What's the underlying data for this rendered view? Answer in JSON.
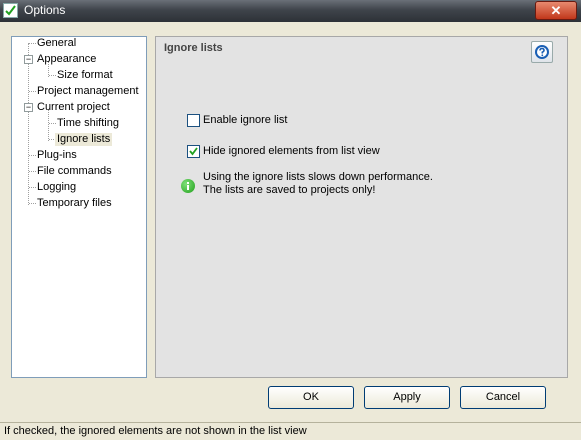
{
  "window": {
    "title": "Options",
    "close_glyph": "✕"
  },
  "tree": [
    {
      "label": "General",
      "level": 0
    },
    {
      "label": "Appearance",
      "level": 0
    },
    {
      "label": "Size format",
      "level": 1
    },
    {
      "label": "Project management",
      "level": 0
    },
    {
      "label": "Current project",
      "level": 0
    },
    {
      "label": "Time shifting",
      "level": 1
    },
    {
      "label": "Ignore lists",
      "level": 1,
      "selected": true
    },
    {
      "label": "Plug-ins",
      "level": 0
    },
    {
      "label": "File commands",
      "level": 0
    },
    {
      "label": "Logging",
      "level": 0
    },
    {
      "label": "Temporary files",
      "level": 0
    }
  ],
  "tree_expanders": {
    "appearance": "−",
    "current_project": "−"
  },
  "panel": {
    "title": "Ignore lists",
    "help_icon": "help-icon",
    "options": [
      {
        "label": "Enable ignore list",
        "checked": false
      },
      {
        "label": "Hide ignored elements from list view",
        "checked": true
      }
    ],
    "info_icon": "info-icon",
    "info_lines": [
      "Using the ignore lists slows down performance.",
      "The lists are saved to projects only!"
    ]
  },
  "buttons": {
    "ok": "OK",
    "apply": "Apply",
    "cancel": "Cancel"
  },
  "status": {
    "text": "If checked, the ignored elements are not shown in the list view"
  },
  "colors": {
    "checkmark": "#21a121",
    "help": "#1a5fb4",
    "info": "#21a01b"
  }
}
